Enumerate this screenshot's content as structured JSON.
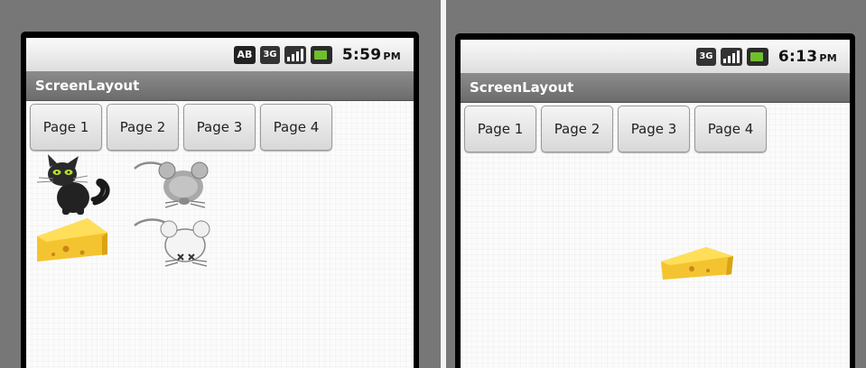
{
  "left_screen": {
    "status": {
      "ab_label": "AB",
      "net_label": "3G",
      "time": "5:59",
      "ampm": "PM"
    },
    "app_title": "ScreenLayout",
    "buttons": [
      "Page 1",
      "Page 2",
      "Page 3",
      "Page 4"
    ],
    "sprites": [
      "cat",
      "mouse",
      "cheese",
      "dead-mouse"
    ]
  },
  "right_screen": {
    "status": {
      "net_label": "3G",
      "time": "6:13",
      "ampm": "PM"
    },
    "app_title": "ScreenLayout",
    "buttons": [
      "Page 1",
      "Page 2",
      "Page 3",
      "Page 4"
    ],
    "sprites": [
      "cheese"
    ]
  },
  "colors": {
    "titlebar": "#7a7a7a",
    "battery": "#6fbf2c",
    "cheese": "#f4c430",
    "cat_eyes": "#b8e02a"
  }
}
